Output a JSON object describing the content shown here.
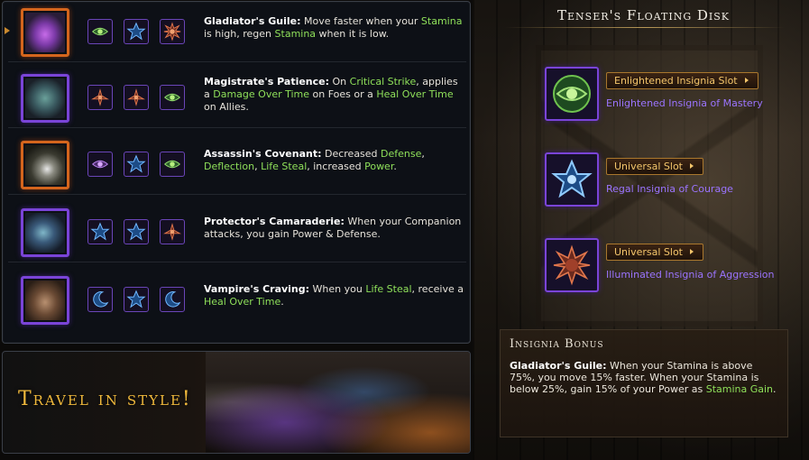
{
  "list": {
    "rows": [
      {
        "name": "Gladiator's Guile:",
        "text_parts": [
          " Move faster when your ",
          "Stamina",
          " is high, regen ",
          "Stamina",
          " when it is low."
        ],
        "frame": "orange",
        "slots": [
          "eye-insignia-icon",
          "star-insignia-icon",
          "burst-insignia-icon"
        ]
      },
      {
        "name": "Magistrate's Patience:",
        "text_parts": [
          " On ",
          "Critical Strike",
          ", applies a ",
          "Damage Over Time",
          " on Foes or a ",
          "Heal Over Time",
          " on Allies."
        ],
        "frame": "purple",
        "slots": [
          "triskelion-insignia-icon",
          "triskelion-insignia-icon",
          "eye-insignia-icon"
        ]
      },
      {
        "name": "Assassin's Covenant:",
        "text_parts": [
          " Decreased ",
          "Defense",
          ", ",
          "Deflection",
          ", ",
          "Life Steal",
          ", increased ",
          "Power",
          "."
        ],
        "frame": "orange",
        "slots": [
          "eye-insignia-icon",
          "star-insignia-icon",
          "eye-insignia-icon"
        ]
      },
      {
        "name": "Protector's Camaraderie:",
        "text_parts": [
          " When your Companion attacks, you gain Power & Defense."
        ],
        "frame": "purple",
        "slots": [
          "star-insignia-icon",
          "star-insignia-icon",
          "triskelion-insignia-icon"
        ]
      },
      {
        "name": "Vampire's Craving:",
        "text_parts": [
          " When you ",
          "Life Steal",
          ", receive a ",
          "Heal Over Time",
          "."
        ],
        "frame": "purple",
        "slots": [
          "moon-insignia-icon",
          "star-insignia-icon",
          "moon-insignia-icon"
        ]
      }
    ]
  },
  "banner": {
    "tagline": "Travel in style!"
  },
  "mount": {
    "title": "Tenser's Floating Disk",
    "slots": [
      {
        "slot_label": "Enlightened Insignia Slot",
        "insignia": "Enlightened Insignia of Mastery",
        "icon": "eye-insignia-icon"
      },
      {
        "slot_label": "Universal Slot",
        "insignia": "Regal Insignia of Courage",
        "icon": "star-insignia-icon"
      },
      {
        "slot_label": "Universal Slot",
        "insignia": "Illuminated Insignia of Aggression",
        "icon": "burst-insignia-icon"
      }
    ]
  },
  "bonus": {
    "title": "Insignia Bonus",
    "name": "Gladiator's Guile:",
    "text_parts": [
      " When your Stamina is above 75%, you move 15% faster. When your Stamina is below 25%, gain 15% of your Power as ",
      "Stamina Gain",
      "."
    ]
  },
  "colors": {
    "highlight_green": "#8fe05a",
    "accent_gold": "#f0b93c",
    "insignia_purple": "#9b74ff"
  }
}
